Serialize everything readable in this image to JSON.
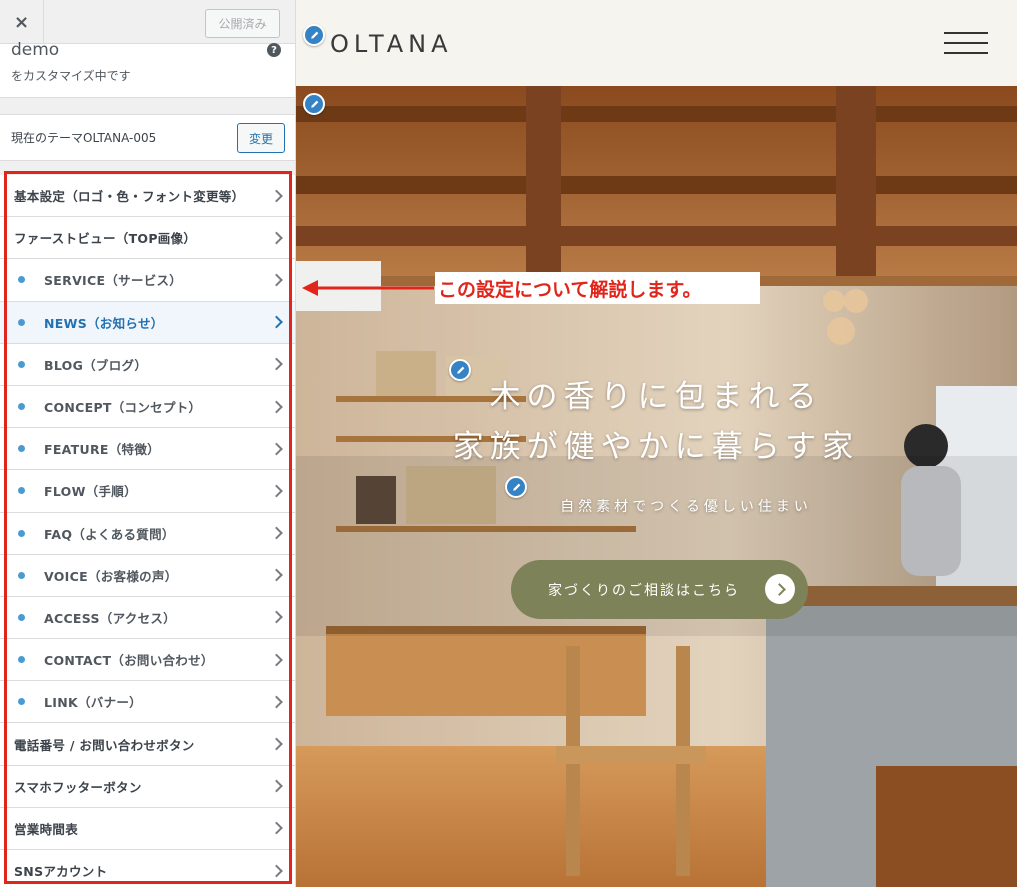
{
  "customizer": {
    "close_icon": "×",
    "publish_label": "公開済み",
    "site_name": "demo",
    "customizing_text": "をカスタマイズ中です",
    "help_icon": "?",
    "theme_label": "現在のテーマOLTANA-005",
    "change_label": "変更",
    "menu_items": [
      {
        "label": "基本設定（ロゴ・色・フォント変更等）"
      },
      {
        "label": "ファーストビュー（TOP画像）"
      },
      {
        "label": "SERVICE（サービス）"
      },
      {
        "label": "NEWS（お知らせ）"
      },
      {
        "label": "BLOG（ブログ）"
      },
      {
        "label": "CONCEPT（コンセプト）"
      },
      {
        "label": "FEATURE（特徴）"
      },
      {
        "label": "FLOW（手順）"
      },
      {
        "label": "FAQ（よくある質問）"
      },
      {
        "label": "VOICE（お客様の声）"
      },
      {
        "label": "ACCESS（アクセス）"
      },
      {
        "label": "CONTACT（お問い合わせ）"
      },
      {
        "label": "LINK（バナー）"
      },
      {
        "label": "電話番号 / お問い合わせボタン"
      },
      {
        "label": "スマホフッターボタン"
      },
      {
        "label": "営業時間表"
      },
      {
        "label": "SNSアカウント"
      }
    ]
  },
  "preview": {
    "logo": "OLTANA",
    "hero_title_line1": "木の香りに包まれる",
    "hero_title_line2": "家族が健やかに暮らす家",
    "hero_sub": "自然素材でつくる優しい住まい",
    "cta_label": "家づくりのご相談はこちら"
  },
  "annotation": {
    "text": "この設定について解説します。"
  },
  "colors": {
    "accent": "#2271b1",
    "highlight_frame": "#e0261b",
    "cta": "#7d8258"
  }
}
